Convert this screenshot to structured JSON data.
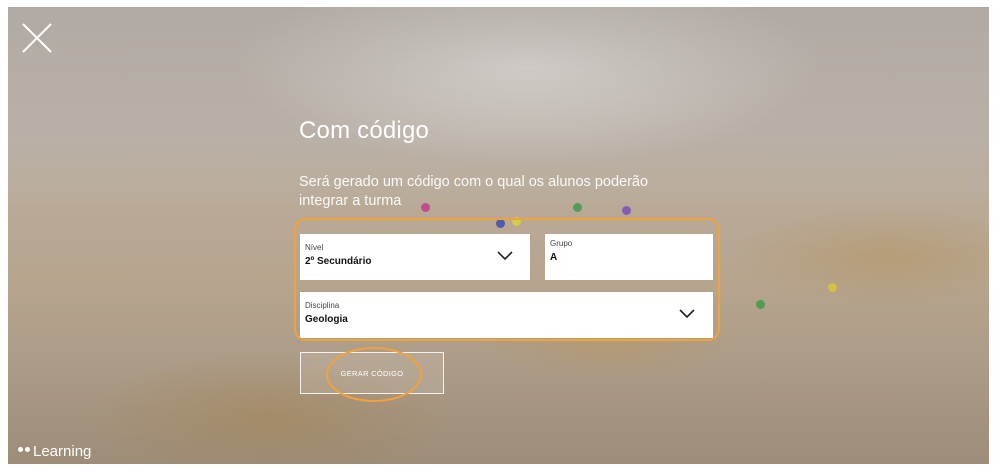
{
  "header": {
    "close_icon": "close-icon"
  },
  "dialog": {
    "title": "Com código",
    "subtitle": "Será gerado um código com o qual os alunos poderão integrar a turma"
  },
  "form": {
    "nivel": {
      "label": "Nível",
      "value": "2º Secundário",
      "icon": "chevron-down-icon"
    },
    "grupo": {
      "label": "Grupo",
      "value": "A"
    },
    "disciplina": {
      "label": "Disciplina",
      "value": "Geologia",
      "icon": "chevron-down-icon"
    }
  },
  "actions": {
    "generate_label": "GERAR CÓDIGO"
  },
  "brand": {
    "name": "Learning"
  },
  "colors": {
    "highlight": "#f2a23a",
    "text_on_photo": "#ffffff",
    "field_background": "#ffffff"
  }
}
